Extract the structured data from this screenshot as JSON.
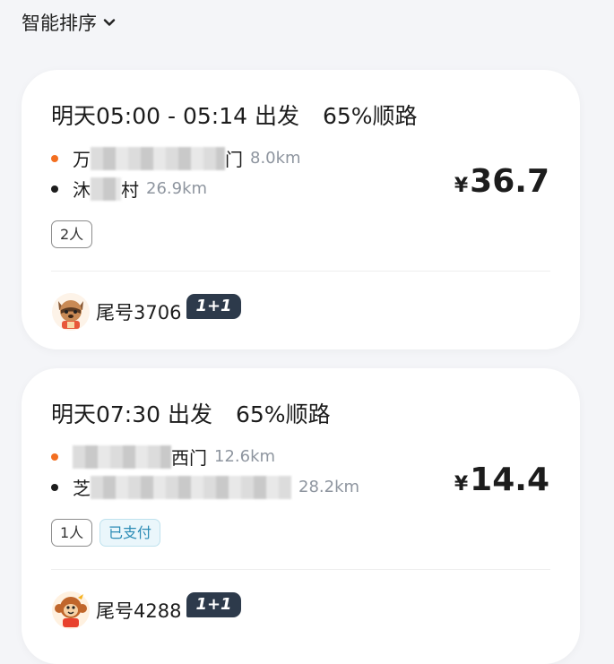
{
  "sort": {
    "label": "智能排序",
    "icon": "chevron-down-icon"
  },
  "orders": [
    {
      "time_text": "明天05:00 - 05:14 出发",
      "match": "65%顺路",
      "start_place_prefix": "万",
      "start_place_suffix": "门",
      "start_dist": "8.0km",
      "end_place_prefix": "沐",
      "end_place_suffix": "村",
      "end_dist": "26.9km",
      "price_symbol": "¥",
      "price": "36.7",
      "passengers": "2人",
      "tail_number": "尾号3706",
      "badge": "1+1",
      "avatar": "raccoon-avatar-icon"
    },
    {
      "time_text": "明天07:30 出发",
      "match": "65%顺路",
      "start_place_suffix": "西门",
      "start_dist": "12.6km",
      "end_place_prefix": "芝",
      "end_dist": "28.2km",
      "price_symbol": "¥",
      "price": "14.4",
      "passengers": "1人",
      "paid": "已支付",
      "tail_number": "尾号4288",
      "badge": "1+1",
      "avatar": "monkey-avatar-icon"
    }
  ],
  "colors": {
    "start_dot": "#f36f21",
    "end_dot": "#1c1c1c",
    "badge_bg": "#2d3a4b",
    "paid_text": "#2a8bb5"
  }
}
